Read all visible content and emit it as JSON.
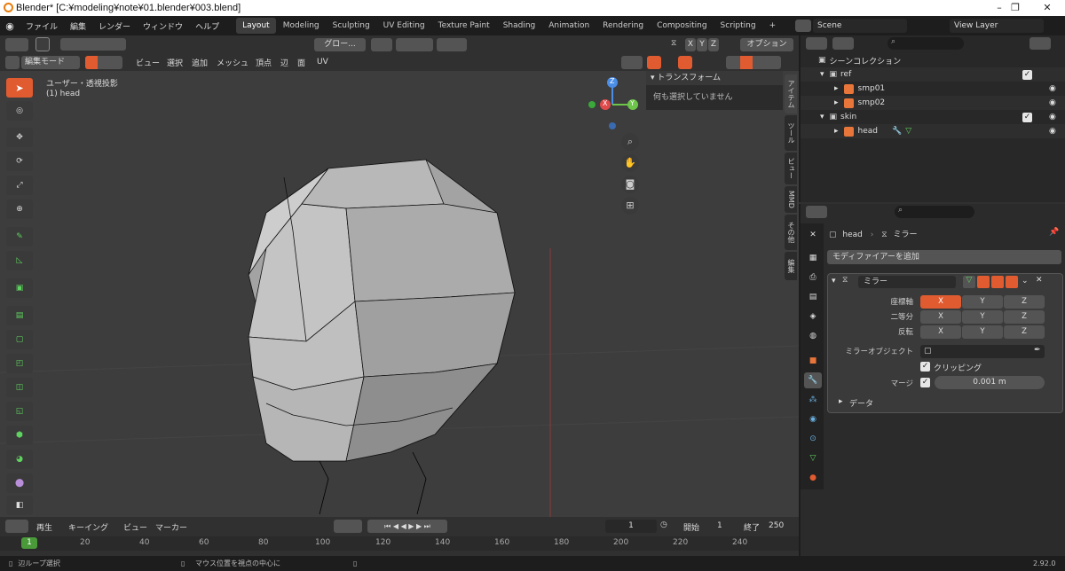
{
  "window": {
    "title": "Blender* [C:¥modeling¥note¥01.blender¥003.blend]",
    "minimize": "–",
    "maximize": "❐",
    "close": "✕"
  },
  "menus": [
    "ファイル",
    "編集",
    "レンダー",
    "ウィンドウ",
    "ヘルプ"
  ],
  "workspaces": [
    "Layout",
    "Modeling",
    "Sculpting",
    "UV Editing",
    "Texture Paint",
    "Shading",
    "Animation",
    "Rendering",
    "Compositing",
    "Scripting",
    "+"
  ],
  "scene": {
    "label": "Scene",
    "view_layer": "View Layer"
  },
  "viewport": {
    "mode": "編集モード",
    "menu": [
      "ビュー",
      "選択",
      "追加",
      "メッシュ",
      "頂点",
      "辺",
      "面",
      "UV"
    ],
    "transform_orient": "グロー...",
    "axes": [
      "X",
      "Y",
      "Z"
    ],
    "options": "オプション",
    "info_line1": "ユーザー・透視投影",
    "info_line2": "(1) head",
    "panel_title": "トランスフォーム",
    "panel_body": "何も選択していません",
    "side_tabs": [
      "アイテム",
      "ツール",
      "ビュー",
      "MMD",
      "その他",
      "編集"
    ]
  },
  "gizmo": {
    "z": "Z",
    "x": "X",
    "y": "Y"
  },
  "timeline": {
    "menu": [
      "再生",
      "キーイング",
      "ビュー",
      "マーカー"
    ],
    "current": "1",
    "start_label": "開始",
    "start": "1",
    "end_label": "終了",
    "end": "250",
    "ticks": [
      "1",
      "20",
      "40",
      "60",
      "80",
      "100",
      "120",
      "140",
      "160",
      "180",
      "200",
      "220",
      "240"
    ]
  },
  "status": {
    "left": "辺ループ選択",
    "mid": "マウス位置を視点の中心に",
    "version": "2.92.0"
  },
  "outliner": {
    "rows": [
      {
        "label": "シーンコレクション",
        "indent": 0
      },
      {
        "label": "ref",
        "indent": 1
      },
      {
        "label": "smp01",
        "indent": 2
      },
      {
        "label": "smp02",
        "indent": 2
      },
      {
        "label": "skin",
        "indent": 1
      },
      {
        "label": "head",
        "indent": 2
      }
    ]
  },
  "properties": {
    "breadcrumb_obj": "head",
    "breadcrumb_mod": "ミラー",
    "add_modifier": "モディファイアーを追加",
    "modifier_name": "ミラー",
    "axis_label": "座標軸",
    "bisect_label": "二等分",
    "flip_label": "反転",
    "xyz": [
      "X",
      "Y",
      "Z"
    ],
    "mirror_object_label": "ミラーオブジェクト",
    "clipping_label": "クリッピング",
    "merge_label": "マージ",
    "merge_value": "0.001 m",
    "data_label": "データ"
  },
  "colors": {
    "accent": "#e05b30",
    "bg": "#303030",
    "viewport": "#3d3d3d"
  }
}
